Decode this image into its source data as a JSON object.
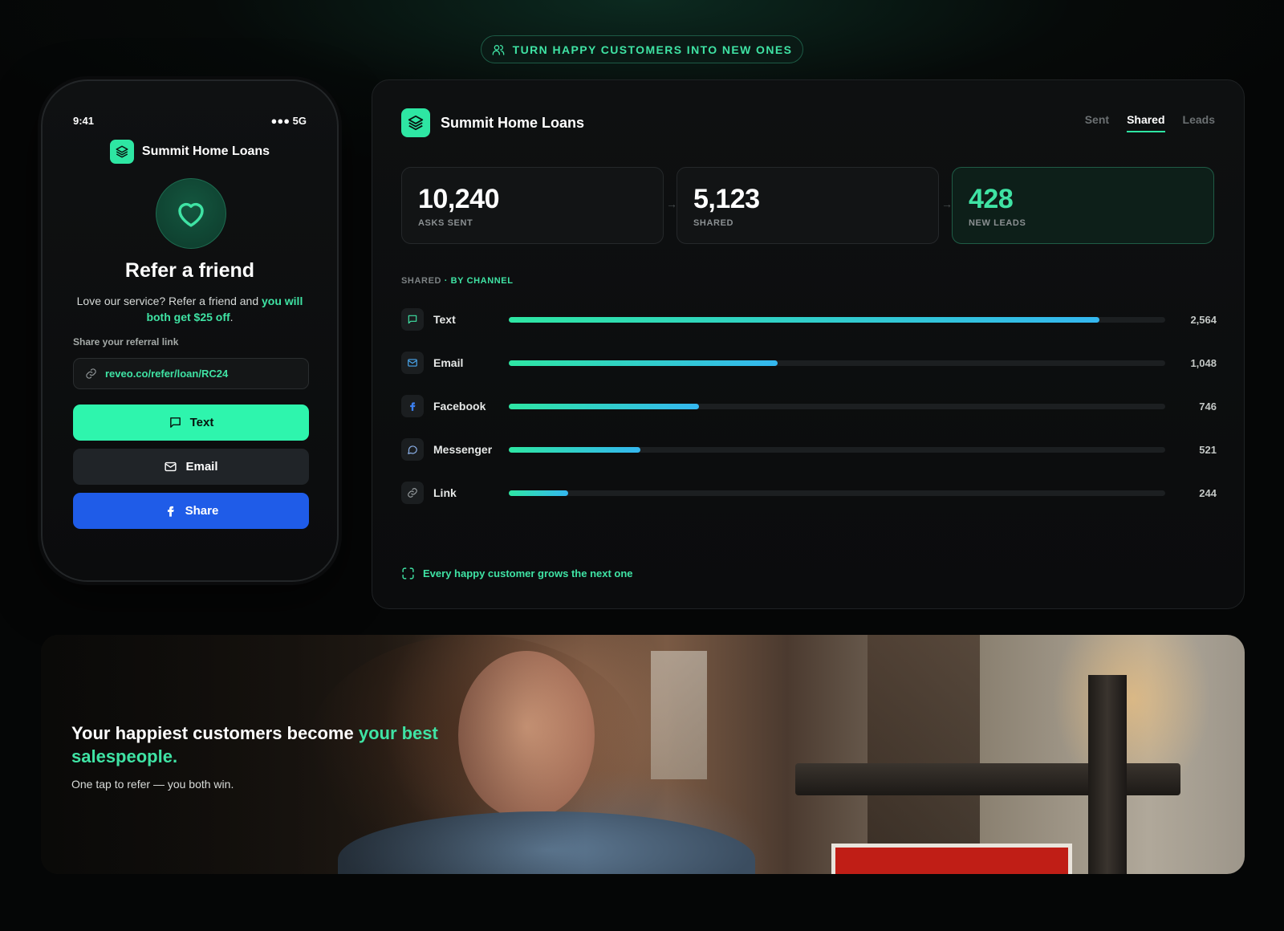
{
  "top_badge": {
    "label": "TURN HAPPY CUSTOMERS INTO NEW ONES",
    "icon": "users-icon"
  },
  "phone": {
    "time": "9:41",
    "signal": "●●● 5G",
    "brand": "Summit Home Loans",
    "title": "Refer a friend",
    "desc_plain": "Love our service? Refer a friend and",
    "desc_highlight": "you will both get $25 off",
    "desc_end": ".",
    "share_label": "Share your referral link",
    "referral_link": "reveo.co/refer/loan/RC24",
    "buttons": {
      "text": "Text",
      "email": "Email",
      "share": "Share"
    }
  },
  "dashboard": {
    "brand": "Summit Home Loans",
    "tabs": [
      {
        "label": "Sent",
        "active": false
      },
      {
        "label": "Shared",
        "active": true
      },
      {
        "label": "Leads",
        "active": false
      }
    ],
    "stats": [
      {
        "value": "10,240",
        "label": "ASKS SENT"
      },
      {
        "value": "5,123",
        "label": "SHARED"
      },
      {
        "value": "428",
        "label": "NEW LEADS"
      }
    ],
    "section_label": "SHARED",
    "section_highlight": "· BY CHANNEL",
    "channels": [
      {
        "name": "Text",
        "value": "2,564",
        "fraction": 0.9,
        "icon": "message-square-icon"
      },
      {
        "name": "Email",
        "value": "1,048",
        "fraction": 0.41,
        "icon": "mail-icon"
      },
      {
        "name": "Facebook",
        "value": "746",
        "fraction": 0.29,
        "icon": "facebook-icon"
      },
      {
        "name": "Messenger",
        "value": "521",
        "fraction": 0.2,
        "icon": "message-circle-icon"
      },
      {
        "name": "Link",
        "value": "244",
        "fraction": 0.09,
        "icon": "link-icon"
      }
    ],
    "footer_note": "Every happy customer grows the next one"
  },
  "hero": {
    "title_plain": "Your happiest customers become",
    "title_highlight": "your best salespeople.",
    "subtitle": "One tap to refer — you both win."
  },
  "colors": {
    "accent_green": "#2ee6a3",
    "text_green": "#3fe3a4",
    "facebook_blue": "#1f5ce8",
    "bar_gradient_end": "#34b7f0"
  }
}
